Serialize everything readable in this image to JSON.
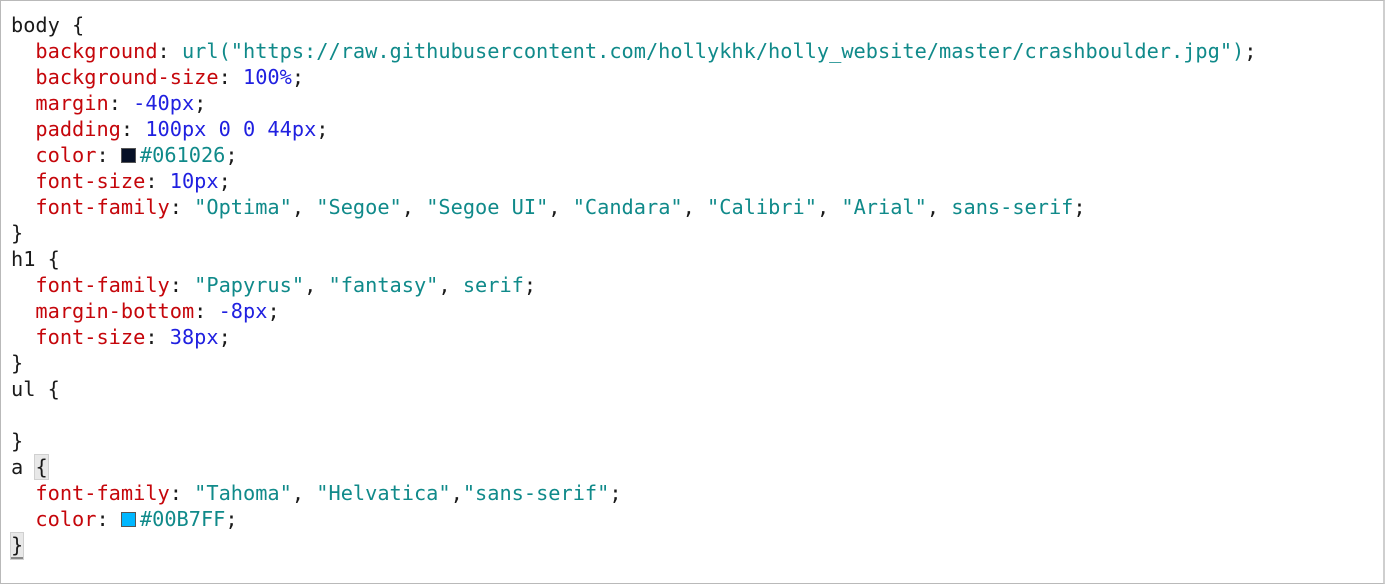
{
  "code": {
    "body_rule": {
      "selector": "body",
      "open": " {",
      "close": "}",
      "decls": [
        {
          "prop": "background",
          "parts": [
            {
              "k": "kw",
              "t": "url("
            },
            {
              "k": "str",
              "t": "\"https://raw.githubusercontent.com/hollykhk/holly_website/master/crashboulder.jpg\""
            },
            {
              "k": "kw",
              "t": ")"
            }
          ]
        },
        {
          "prop": "background-size",
          "parts": [
            {
              "k": "num",
              "t": "100%"
            }
          ]
        },
        {
          "prop": "margin",
          "parts": [
            {
              "k": "num",
              "t": "-40px"
            }
          ]
        },
        {
          "prop": "padding",
          "parts": [
            {
              "k": "num",
              "t": "100px 0 0 44px"
            }
          ]
        },
        {
          "prop": "color",
          "swatch": "#061026",
          "parts": [
            {
              "k": "str",
              "t": "#061026"
            }
          ]
        },
        {
          "prop": "font-size",
          "parts": [
            {
              "k": "num",
              "t": "10px"
            }
          ]
        },
        {
          "prop": "font-family",
          "parts": [
            {
              "k": "str",
              "t": "\"Optima\""
            },
            {
              "k": "punc",
              "t": ", "
            },
            {
              "k": "str",
              "t": "\"Segoe\""
            },
            {
              "k": "punc",
              "t": ", "
            },
            {
              "k": "str",
              "t": "\"Segoe UI\""
            },
            {
              "k": "punc",
              "t": ", "
            },
            {
              "k": "str",
              "t": "\"Candara\""
            },
            {
              "k": "punc",
              "t": ", "
            },
            {
              "k": "str",
              "t": "\"Calibri\""
            },
            {
              "k": "punc",
              "t": ", "
            },
            {
              "k": "str",
              "t": "\"Arial\""
            },
            {
              "k": "punc",
              "t": ", "
            },
            {
              "k": "kw",
              "t": "sans-serif"
            }
          ]
        }
      ]
    },
    "h1_rule": {
      "selector": "h1",
      "open": " {",
      "close": "}",
      "decls": [
        {
          "prop": "font-family",
          "parts": [
            {
              "k": "str",
              "t": "\"Papyrus\""
            },
            {
              "k": "punc",
              "t": ", "
            },
            {
              "k": "str",
              "t": "\"fantasy\""
            },
            {
              "k": "punc",
              "t": ", "
            },
            {
              "k": "kw",
              "t": "serif"
            }
          ]
        },
        {
          "prop": "margin-bottom",
          "parts": [
            {
              "k": "num",
              "t": "-8px"
            }
          ]
        },
        {
          "prop": "font-size",
          "parts": [
            {
              "k": "num",
              "t": "38px"
            }
          ]
        }
      ]
    },
    "ul_rule": {
      "selector": "ul",
      "open": " {",
      "close": "}",
      "decls": []
    },
    "a_rule": {
      "selector": "a",
      "open": "{",
      "close": "}",
      "decls": [
        {
          "prop": "font-family",
          "parts": [
            {
              "k": "str",
              "t": "\"Tahoma\""
            },
            {
              "k": "punc",
              "t": ", "
            },
            {
              "k": "str",
              "t": "\"Helvatica\""
            },
            {
              "k": "punc",
              "t": ","
            },
            {
              "k": "str",
              "t": "\"sans-serif\""
            }
          ]
        },
        {
          "prop": "color",
          "swatch": "#00B7FF",
          "parts": [
            {
              "k": "str",
              "t": "#00B7FF"
            }
          ]
        }
      ]
    }
  },
  "colors": {
    "property": "#c5060b",
    "number": "#2020e0",
    "string": "#108a8a",
    "text": "#1a1a1a"
  }
}
